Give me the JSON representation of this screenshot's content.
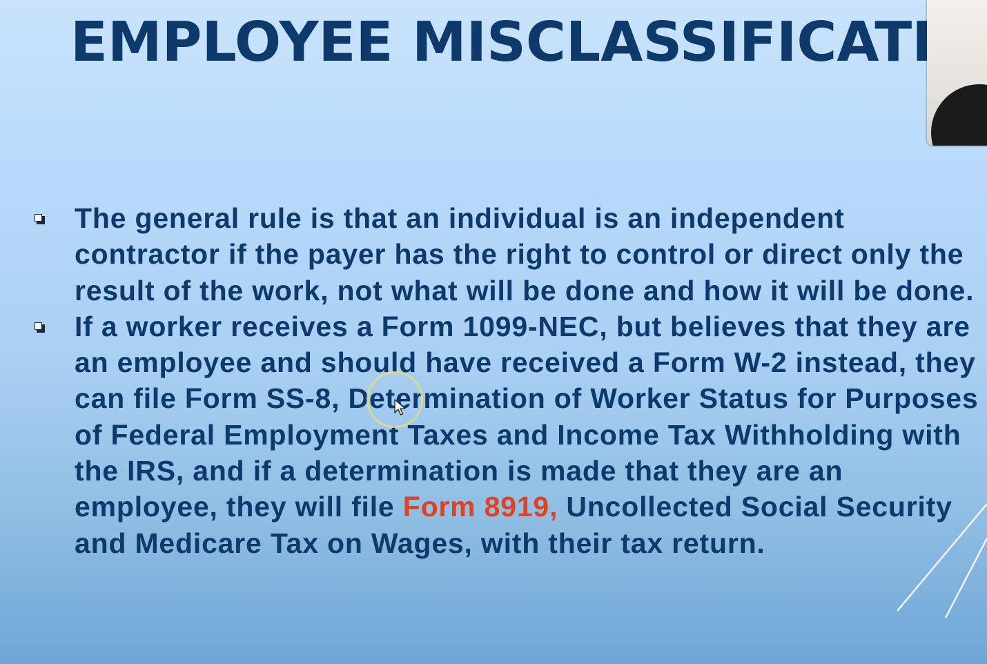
{
  "slide": {
    "title": "EMPLOYEE MISCLASSIFICATION",
    "bullets": [
      {
        "text": "The general rule is that an individual is an independent contractor if the payer has the right to control or direct only the result of the work, not what will be done and how it will be done."
      },
      {
        "text_before": "If a worker receives a Form 1099-NEC, but believes that they are an employee and should have received a Form W-2 instead, they can file Form SS-8, Determination of Worker Status for Purposes of Federal Employment Taxes and Income Tax Withholding with the IRS, and if a determination is made that they are an employee, they will file ",
        "text_highlight": "Form 8919,",
        "text_after": " Uncollected Social Security and Medicare Tax on Wages, with their tax return."
      }
    ]
  },
  "icons": {
    "bullet_marker": "checkbox-square-icon",
    "cursor": "mouse-pointer-icon"
  },
  "colors": {
    "title": "#0d3a6b",
    "body_text": "#0d3a6b",
    "highlight": "#e0421e",
    "background_top": "#c9e3fb",
    "background_bottom": "#6ea6d6",
    "cursor_ring": "#e8dc78"
  }
}
